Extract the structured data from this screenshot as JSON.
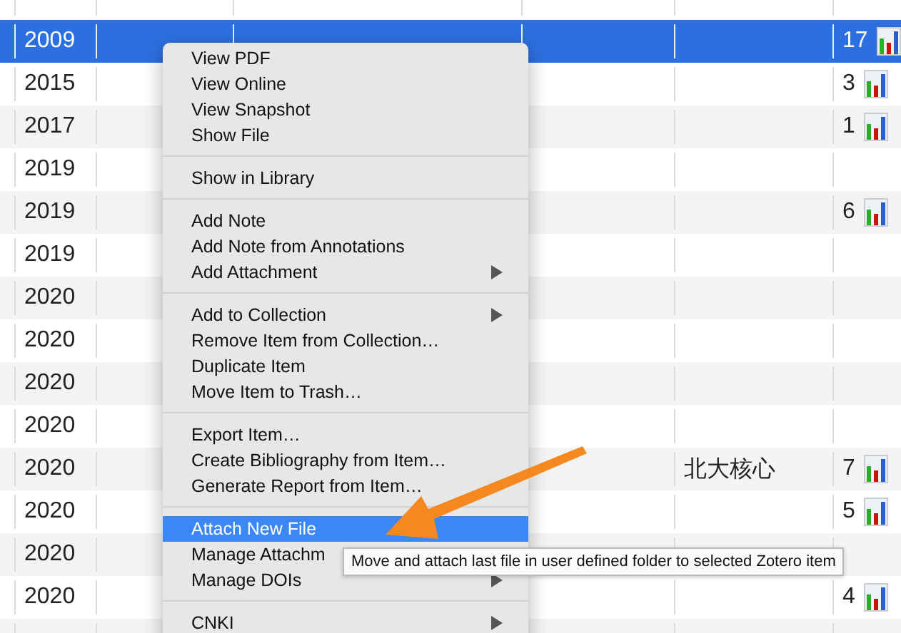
{
  "table": {
    "rows": [
      {
        "year": "2009",
        "count": "17",
        "selected": true
      },
      {
        "year": "2015",
        "count": "3",
        "selected": false
      },
      {
        "year": "2017",
        "count": "1",
        "selected": false
      },
      {
        "year": "2019",
        "selected": false
      },
      {
        "year": "2019",
        "count": "6",
        "selected": false
      },
      {
        "year": "2019",
        "selected": false
      },
      {
        "year": "2020",
        "selected": false
      },
      {
        "year": "2020",
        "selected": false
      },
      {
        "year": "2020",
        "selected": false
      },
      {
        "year": "2020",
        "selected": false
      },
      {
        "year": "2020",
        "tag": "北大核心",
        "count": "7",
        "selected": false
      },
      {
        "year": "2020",
        "count": "5",
        "selected": false
      },
      {
        "year": "2020",
        "selected": false
      },
      {
        "year": "2020",
        "count": "4",
        "selected": false
      }
    ]
  },
  "context_menu": {
    "items": [
      {
        "kind": "item",
        "label": "View PDF",
        "submenu": false,
        "selected": false
      },
      {
        "kind": "item",
        "label": "View Online",
        "submenu": false,
        "selected": false
      },
      {
        "kind": "item",
        "label": "View Snapshot",
        "submenu": false,
        "selected": false
      },
      {
        "kind": "item",
        "label": "Show File",
        "submenu": false,
        "selected": false
      },
      {
        "kind": "separator"
      },
      {
        "kind": "item",
        "label": "Show in Library",
        "submenu": false,
        "selected": false
      },
      {
        "kind": "separator"
      },
      {
        "kind": "item",
        "label": "Add Note",
        "submenu": false,
        "selected": false
      },
      {
        "kind": "item",
        "label": "Add Note from Annotations",
        "submenu": false,
        "selected": false
      },
      {
        "kind": "item",
        "label": "Add Attachment",
        "submenu": true,
        "selected": false
      },
      {
        "kind": "separator"
      },
      {
        "kind": "item",
        "label": "Add to Collection",
        "submenu": true,
        "selected": false
      },
      {
        "kind": "item",
        "label": "Remove Item from Collection…",
        "submenu": false,
        "selected": false
      },
      {
        "kind": "item",
        "label": "Duplicate Item",
        "submenu": false,
        "selected": false
      },
      {
        "kind": "item",
        "label": "Move Item to Trash…",
        "submenu": false,
        "selected": false
      },
      {
        "kind": "separator"
      },
      {
        "kind": "item",
        "label": "Export Item…",
        "submenu": false,
        "selected": false
      },
      {
        "kind": "item",
        "label": "Create Bibliography from Item…",
        "submenu": false,
        "selected": false
      },
      {
        "kind": "item",
        "label": "Generate Report from Item…",
        "submenu": false,
        "selected": false
      },
      {
        "kind": "separator"
      },
      {
        "kind": "item",
        "label": "Attach New File",
        "submenu": false,
        "selected": true
      },
      {
        "kind": "item",
        "label": "Manage Attachm",
        "submenu": false,
        "selected": false
      },
      {
        "kind": "item",
        "label": "Manage DOIs",
        "submenu": true,
        "selected": false
      },
      {
        "kind": "separator"
      },
      {
        "kind": "item",
        "label": "CNKI",
        "submenu": true,
        "selected": false
      }
    ]
  },
  "tooltip": {
    "text": "Move and attach last file in user defined folder to selected Zotero item"
  }
}
